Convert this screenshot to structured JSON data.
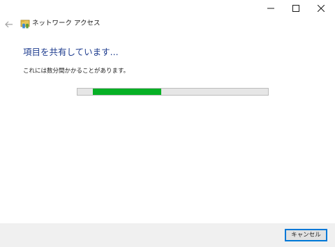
{
  "window": {
    "title": "ネットワーク アクセス",
    "controls": [
      "minimize-icon",
      "maximize-icon",
      "close-icon"
    ]
  },
  "header": {
    "back_icon": "back-arrow-icon",
    "app_icon": "network-share-icon",
    "title": "ネットワーク アクセス"
  },
  "main": {
    "heading": "項目を共有しています...",
    "message": "これには数分間かかることがあります。",
    "progress": {
      "state": "indeterminate",
      "segment_start": 0.08,
      "segment_fraction": 0.36,
      "color": "#06b025"
    }
  },
  "footer": {
    "cancel_label": "キャンセル"
  },
  "colors": {
    "heading": "#1f3d8f",
    "accent": "#0078d7",
    "progress_fill": "#06b025",
    "footer_bg": "#f0f0f0"
  }
}
